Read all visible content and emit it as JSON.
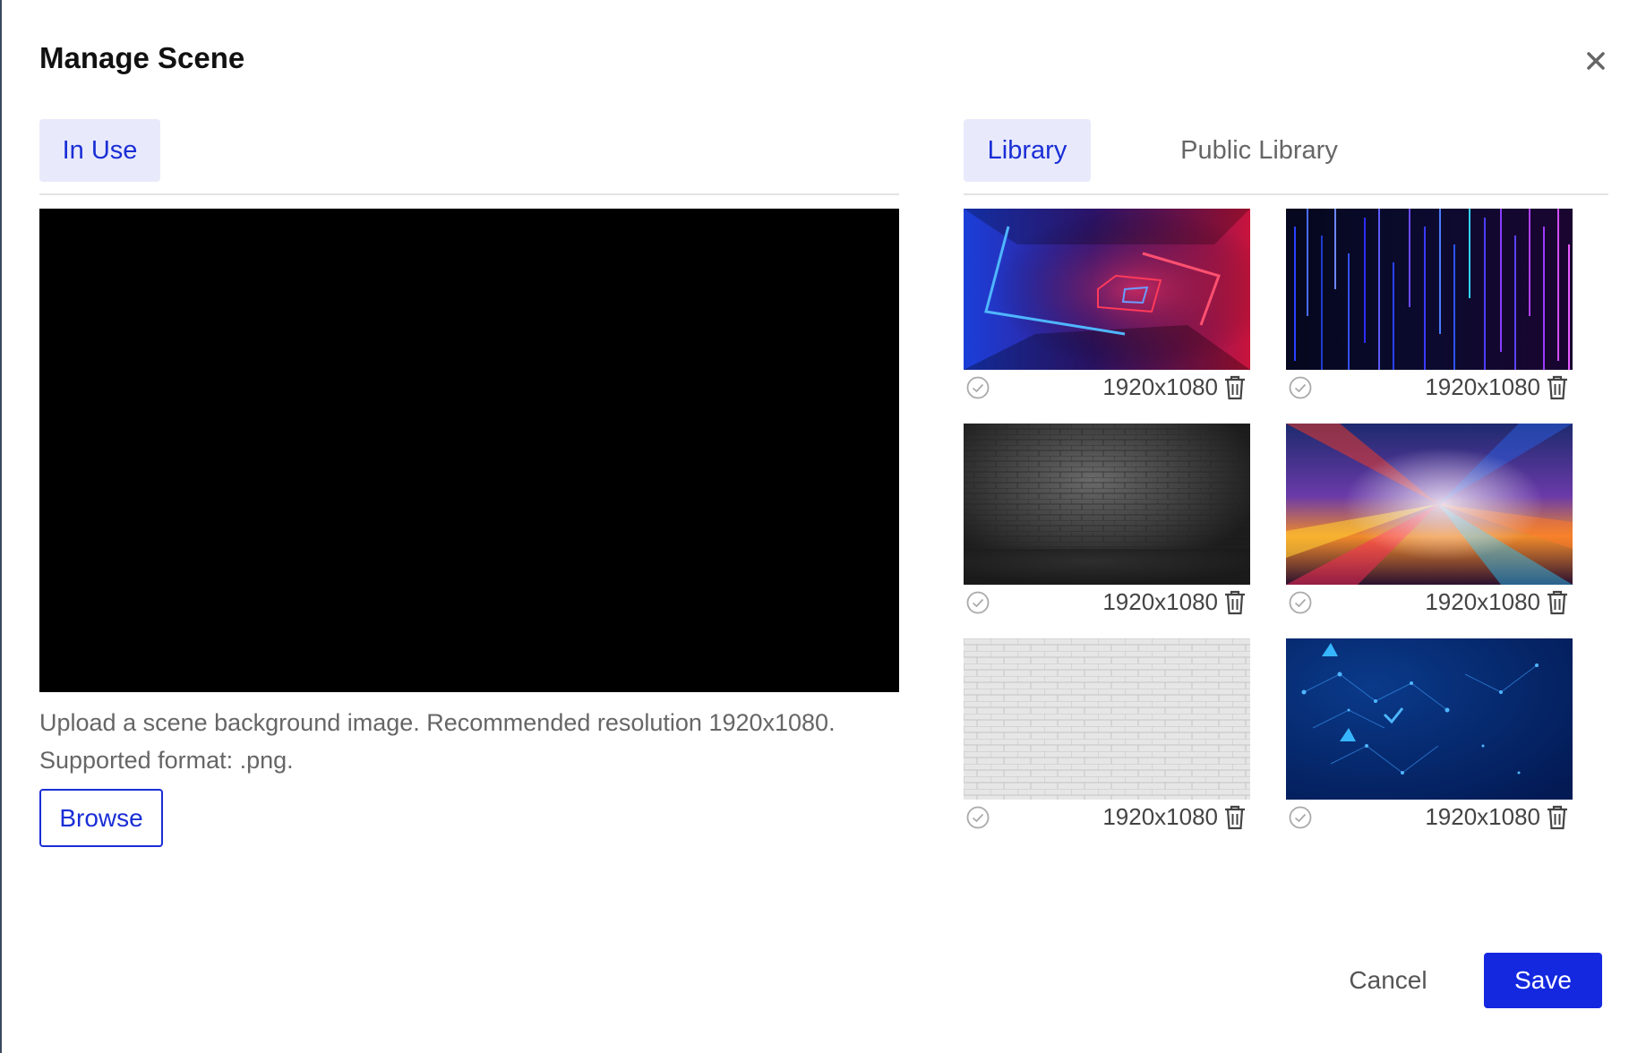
{
  "dialog": {
    "title": "Manage Scene",
    "close_icon": "close-icon"
  },
  "left": {
    "tabs": [
      {
        "label": "In Use",
        "active": true
      }
    ],
    "hint_line1": "Upload a scene background image. Recommended resolution 1920x1080.",
    "hint_line2": "Supported format: .png.",
    "browse_label": "Browse"
  },
  "right": {
    "tabs": [
      {
        "label": "Library",
        "active": true
      },
      {
        "label": "Public Library",
        "active": false
      }
    ],
    "items": [
      {
        "resolution": "1920x1080",
        "theme": "neon-red-blue-tunnel",
        "check_icon": "check-circle-icon",
        "delete_icon": "trash-icon"
      },
      {
        "resolution": "1920x1080",
        "theme": "neon-vertical-lines",
        "check_icon": "check-circle-icon",
        "delete_icon": "trash-icon"
      },
      {
        "resolution": "1920x1080",
        "theme": "dark-brick-wall",
        "check_icon": "check-circle-icon",
        "delete_icon": "trash-icon"
      },
      {
        "resolution": "1920x1080",
        "theme": "blurred-city-lights",
        "check_icon": "check-circle-icon",
        "delete_icon": "trash-icon"
      },
      {
        "resolution": "1920x1080",
        "theme": "white-brick-wall",
        "check_icon": "check-circle-icon",
        "delete_icon": "trash-icon"
      },
      {
        "resolution": "1920x1080",
        "theme": "blue-network-tech",
        "check_icon": "check-circle-icon",
        "delete_icon": "trash-icon"
      }
    ]
  },
  "footer": {
    "cancel_label": "Cancel",
    "save_label": "Save"
  },
  "colors": {
    "accent": "#1a2ed6",
    "save_bg": "#1428e0",
    "tab_active_bg": "#e8eafb"
  }
}
